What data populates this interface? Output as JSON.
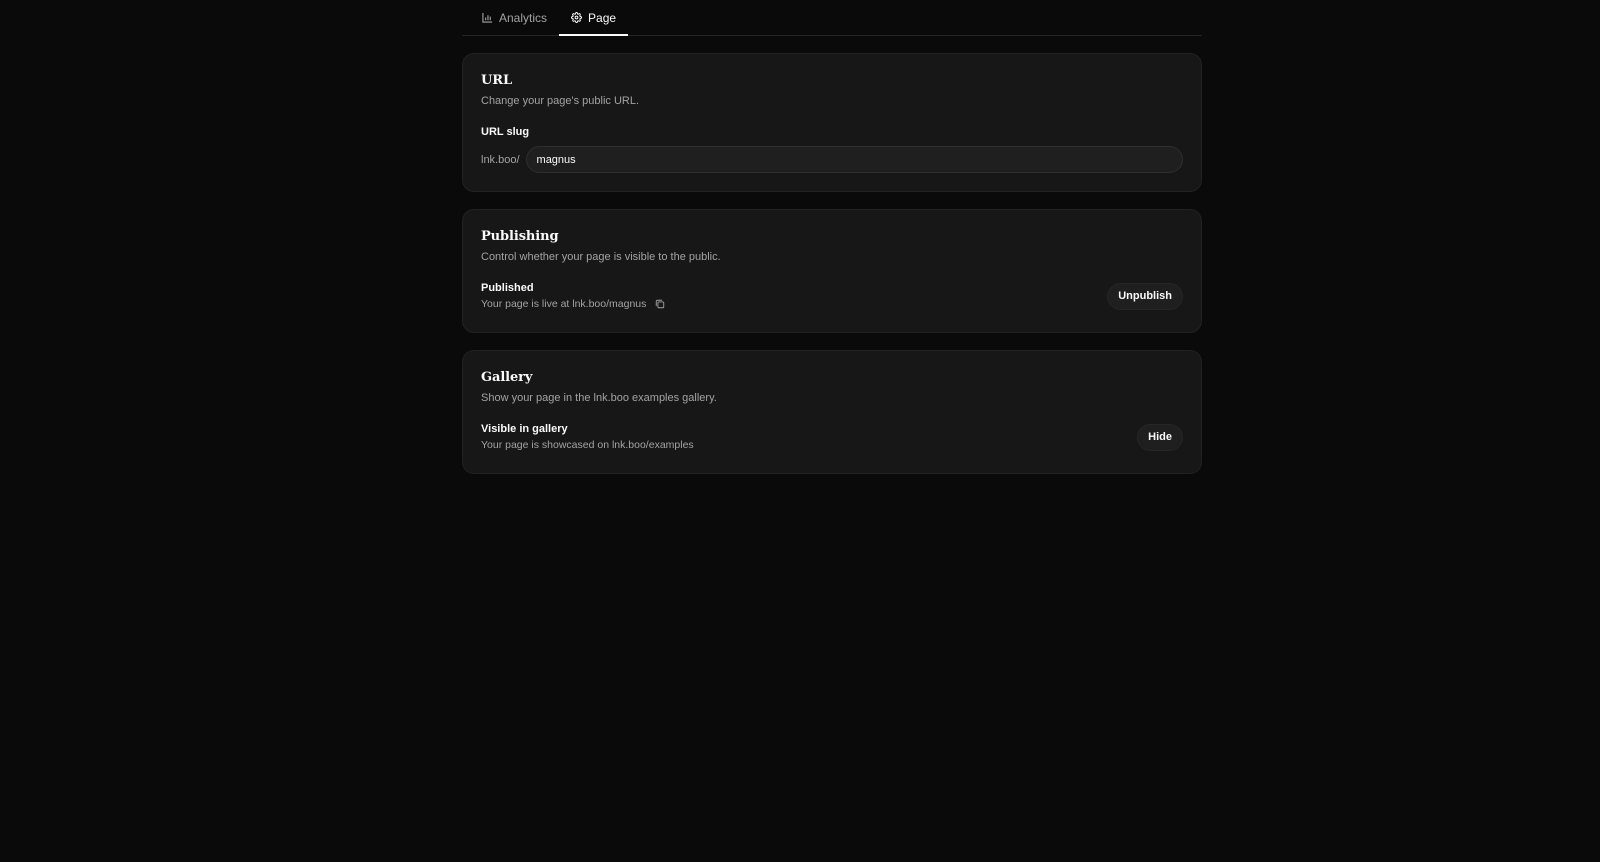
{
  "tabs": [
    {
      "label": "Analytics",
      "icon": "bar-chart-icon",
      "active": false
    },
    {
      "label": "Page",
      "icon": "gear-icon",
      "active": true
    }
  ],
  "url_card": {
    "title": "URL",
    "description": "Change your page's public URL.",
    "field_label": "URL slug",
    "prefix": "lnk.boo/",
    "slug_value": "magnus"
  },
  "publishing_card": {
    "title": "Publishing",
    "description": "Control whether your page is visible to the public.",
    "status_title": "Published",
    "status_text": "Your page is live at lnk.boo/magnus",
    "action_label": "Unpublish"
  },
  "gallery_card": {
    "title": "Gallery",
    "description": "Show your page in the lnk.boo examples gallery.",
    "status_title": "Visible in gallery",
    "status_text": "Your page is showcased on lnk.boo/examples",
    "action_label": "Hide"
  },
  "colors": {
    "background": "#0a0a0a",
    "card": "#171717",
    "text": "#fafafa",
    "muted": "#a3a3a3"
  }
}
